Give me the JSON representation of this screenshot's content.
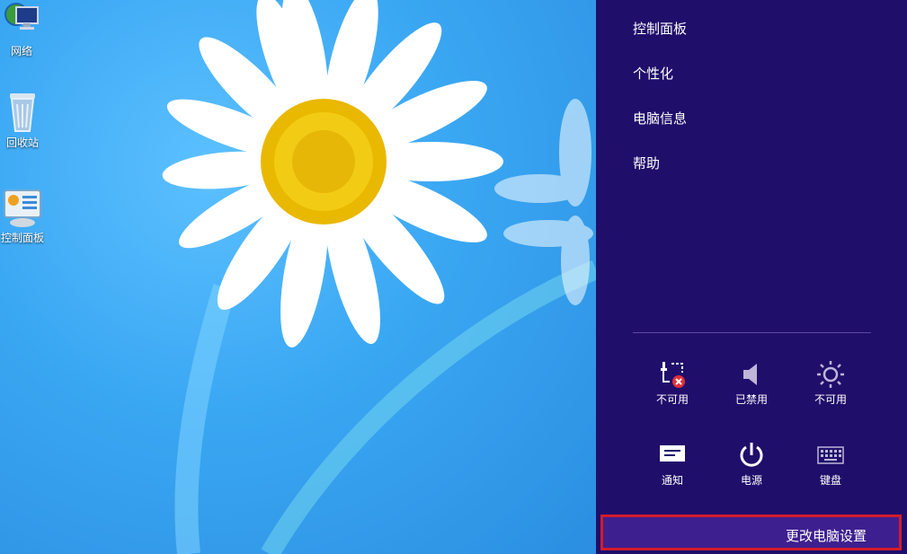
{
  "desktop": {
    "icons": [
      {
        "label": "网络",
        "icon": "network-icon"
      },
      {
        "label": "回收站",
        "icon": "recycle-bin-icon"
      },
      {
        "label": "控制面板",
        "icon": "control-panel-icon"
      }
    ]
  },
  "settings_charm": {
    "links": [
      "控制面板",
      "个性化",
      "电脑信息",
      "帮助"
    ],
    "quick_settings": [
      {
        "label": "不可用",
        "icon": "network-unavailable-icon"
      },
      {
        "label": "已禁用",
        "icon": "volume-icon"
      },
      {
        "label": "不可用",
        "icon": "brightness-icon"
      },
      {
        "label": "通知",
        "icon": "notifications-icon"
      },
      {
        "label": "电源",
        "icon": "power-icon"
      },
      {
        "label": "键盘",
        "icon": "keyboard-icon"
      }
    ],
    "change_pc_settings": "更改电脑设置"
  },
  "colors": {
    "charm_background": "#200e6b",
    "highlight_border": "#d21c2c",
    "desktop_blue": "#3aa7f3"
  }
}
